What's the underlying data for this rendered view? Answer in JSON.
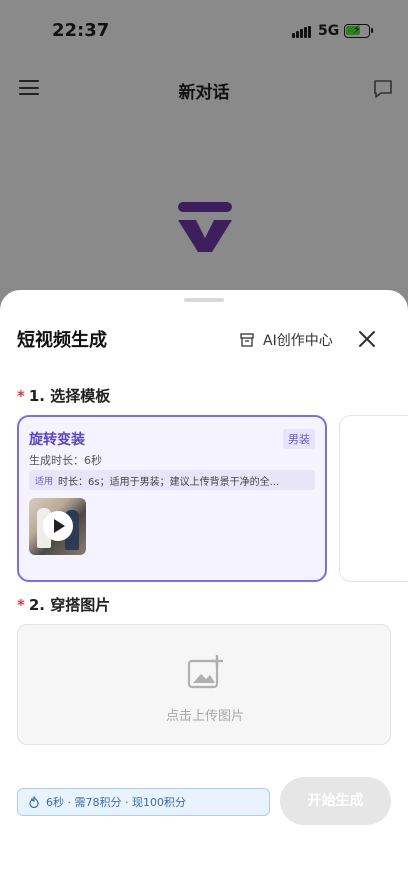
{
  "status_bar": {
    "time": "22:37",
    "network": "5G"
  },
  "nav": {
    "title": "新对话"
  },
  "sheet": {
    "title": "短视频生成",
    "ai_center_label": "AI创作中心",
    "section1": {
      "required_mark": "*",
      "label": "1. 选择模板"
    },
    "template": {
      "name": "旋转变装",
      "tag": "男装",
      "duration": "生成时长：6秒",
      "apply_label": "适用",
      "description": "时长：6s；适用于男装；建议上传背景干净的全..."
    },
    "section2": {
      "required_mark": "*",
      "label": "2. 穿搭图片"
    },
    "upload_text": "点击上传图片",
    "cost_text": "6秒 · 需78积分 · 现100积分",
    "start_button": "开始生成"
  },
  "colors": {
    "accent": "#7d6ee0",
    "required": "#e53935",
    "info": "#3a6ea5"
  }
}
